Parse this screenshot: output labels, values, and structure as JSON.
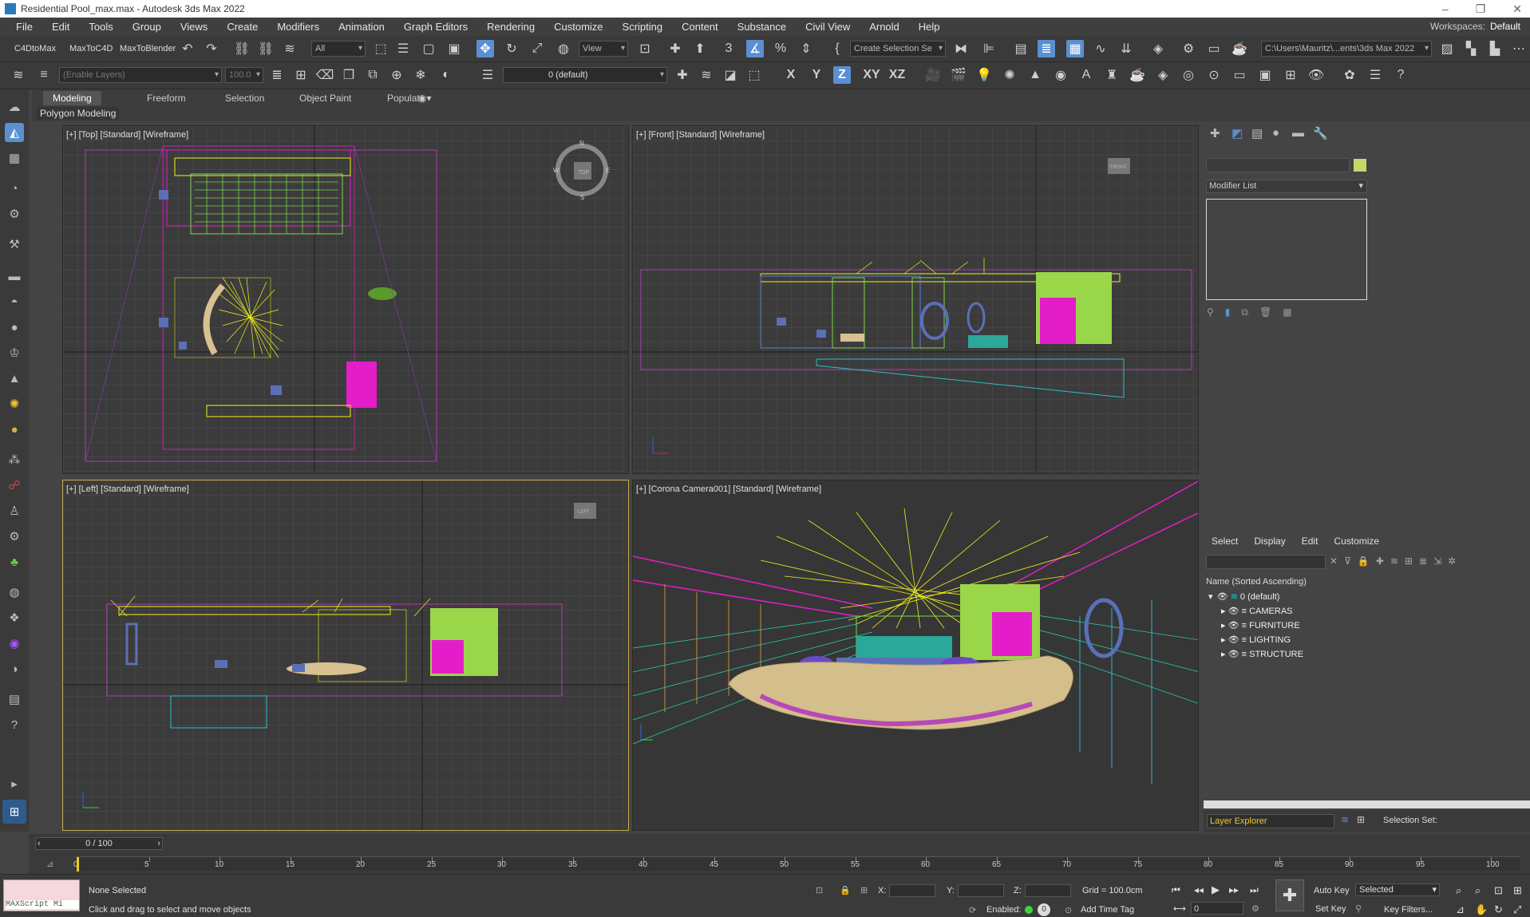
{
  "window": {
    "title": "Residential Pool_max.max - Autodesk 3ds Max 2022"
  },
  "menu": [
    "File",
    "Edit",
    "Tools",
    "Group",
    "Views",
    "Create",
    "Modifiers",
    "Animation",
    "Graph Editors",
    "Rendering",
    "Customize",
    "Scripting",
    "Content",
    "Substance",
    "Civil View",
    "Arnold",
    "Help"
  ],
  "workspaces": {
    "label": "Workspaces:",
    "value": "Default"
  },
  "toolbar": {
    "plugin1": "C4DtoMax",
    "plugin2": "MaxToC4D",
    "plugin3": "MaxToBlender",
    "filter": "All",
    "ref_coord": "View",
    "selection_set": "Create Selection Se",
    "path": "C:\\Users\\Mauritz\\...ents\\3ds Max 2022",
    "layers_placeholder": "(Enable Layers)",
    "layer_value": "100.0",
    "current_layer": "0 (default)",
    "axis_x": "X",
    "axis_y": "Y",
    "axis_z": "Z",
    "axis_xy": "XY",
    "axis_xz": "XZ"
  },
  "ribbon": {
    "tabs": [
      "Modeling",
      "Freeform",
      "Selection",
      "Object Paint",
      "Populate"
    ],
    "active_sub": "Polygon Modeling"
  },
  "viewports": {
    "top": "[+] [Top] [Standard] [Wireframe]",
    "front": "[+] [Front] [Standard] [Wireframe]",
    "left": "[+] [Left] [Standard] [Wireframe]",
    "camera": "[+] [Corona Camera001] [Standard] [Wireframe]",
    "cube_top": "TOP",
    "cube_front": "FRONT",
    "cube_left": "LEFT",
    "compass_n": "N",
    "compass_s": "S",
    "compass_e": "E",
    "compass_w": "W"
  },
  "command_panel": {
    "modifier_list": "Modifier List"
  },
  "scene_explorer": {
    "menu": [
      "Select",
      "Display",
      "Edit",
      "Customize"
    ],
    "sort_label": "Name (Sorted Ascending)",
    "root": "0 (default)",
    "layers": [
      "CAMERAS",
      "FURNITURE",
      "LIGHTING",
      "STRUCTURE"
    ],
    "explorer": "Layer Explorer",
    "selection_set_label": "Selection Set:"
  },
  "timeline": {
    "frame_display": "0 / 100",
    "ticks": [
      "0",
      "5",
      "10",
      "15",
      "20",
      "25",
      "30",
      "35",
      "40",
      "45",
      "50",
      "55",
      "60",
      "65",
      "70",
      "75",
      "80",
      "85",
      "90",
      "95",
      "100"
    ]
  },
  "status": {
    "script_label": "MAXScript Mi",
    "selection": "None Selected",
    "prompt": "Click and drag to select and move objects",
    "x_label": "X:",
    "y_label": "Y:",
    "z_label": "Z:",
    "grid": "Grid = 100.0cm",
    "enabled": "Enabled:",
    "add_time_tag": "Add Time Tag",
    "auto_key": "Auto Key",
    "key_mode": "Selected",
    "set_key": "Set Key",
    "key_filters": "Key Filters...",
    "frame": "0"
  },
  "colors": {
    "accent": "#5b8fd1",
    "active_viewport": "#c6a84a",
    "yellow": "#f2f21c",
    "magenta": "#e31ec8",
    "green": "#9ad64a"
  }
}
